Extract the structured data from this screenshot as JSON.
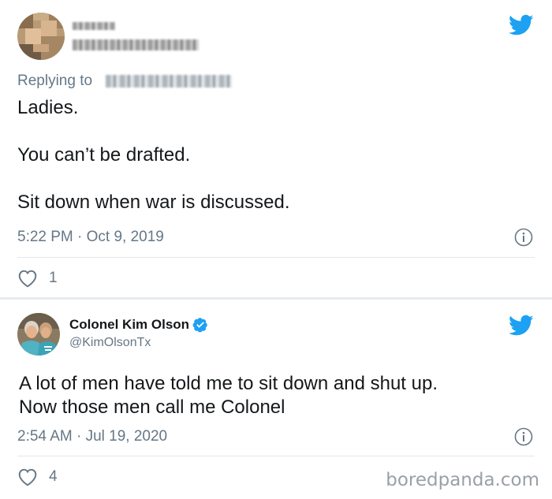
{
  "tweet1": {
    "replying_prefix": "Replying to",
    "text": "Ladies.\n\nYou can’t be drafted.\n\nSit down when war is discussed.",
    "timestamp": "5:22 PM · Oct 9, 2019",
    "likes": "1",
    "icons": {
      "brand": "twitter-bird-icon",
      "info": "info-icon",
      "like": "heart-icon"
    }
  },
  "tweet2": {
    "display_name": "Colonel Kim Olson",
    "handle": "@KimOlsonTx",
    "text": "A lot of men have told me to sit down and shut up.\nNow those men call me Colonel",
    "timestamp": "2:54 AM · Jul 19, 2020",
    "likes": "4",
    "icons": {
      "brand": "twitter-bird-icon",
      "info": "info-icon",
      "like": "heart-icon",
      "verified": "verified-badge-icon"
    }
  },
  "watermark": "boredpanda.com",
  "colors": {
    "twitter_blue": "#1da1f2",
    "meta_gray": "#657786",
    "text": "#14171a",
    "divider": "#e1e8ed"
  }
}
